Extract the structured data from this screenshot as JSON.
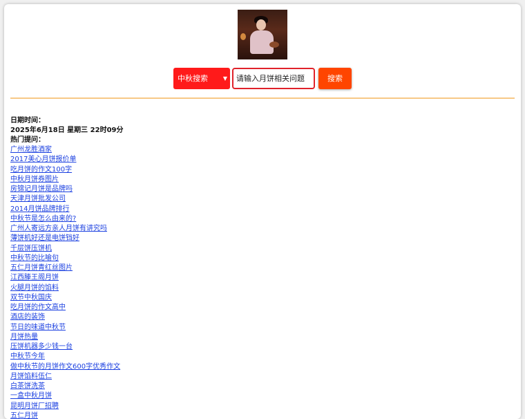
{
  "search": {
    "select_value": "中秋搜索",
    "input_placeholder": "请输入月饼相关问题",
    "button_label": "搜索"
  },
  "info": {
    "date_label": "日期时间：",
    "date_value": "2025年6月18日 星期三 22时09分",
    "hot_label": "热门提问："
  },
  "hot_links": [
    "广州龙胜酒家",
    "2017美心月饼报价单",
    "吃月饼的作文100字",
    "中秋月饼券图片",
    "房锦记月饼是品牌吗",
    "天津月饼批发公司",
    "2014月饼品牌排行",
    "中秋节是怎么由来的?",
    "广州人寄远方亲人月饼有讲究吗",
    "薄饼机好还是电饼铛好",
    "千层饼压饼机",
    "中秋节的比喻句",
    "五仁月饼青红丝图片",
    "江西滕王阁月饼",
    "火腿月饼的馅料",
    "双节中秋国庆",
    "吃月饼的作文高中",
    "酒店的装饰",
    "节日的味道中秋节",
    "月饼热量",
    "压饼机器多少钱一台",
    "中秋节今年",
    "做中秋节的月饼作文600字优秀作文",
    "月饼馅料伍仁",
    "白茶饼洗茶",
    "一盒中秋月饼",
    "昆明月饼厂招聘",
    "五仁月饼"
  ]
}
